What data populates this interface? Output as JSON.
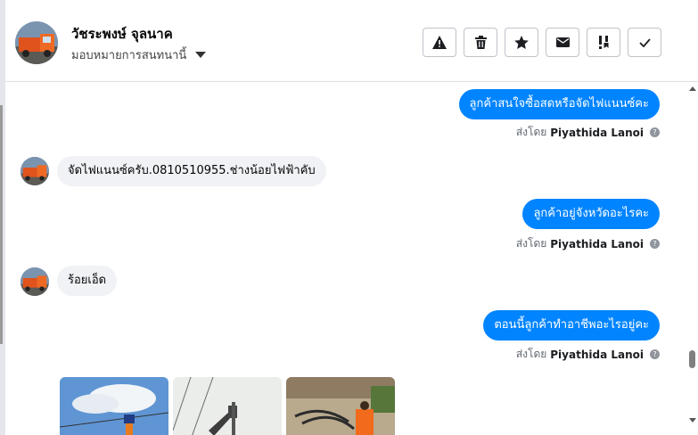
{
  "header": {
    "contact_name": "วัชระพงษ์ จุลนาค",
    "assign_label": "มอบหมายการสนทนานี้",
    "toolbar": [
      {
        "icon": "warning-icon",
        "name": "spam-button"
      },
      {
        "icon": "trash-icon",
        "name": "delete-button"
      },
      {
        "icon": "star-icon",
        "name": "star-button"
      },
      {
        "icon": "envelope-icon",
        "name": "mark-unread-button"
      },
      {
        "icon": "priority-icon",
        "name": "follow-up-button"
      },
      {
        "icon": "check-icon",
        "name": "mark-done-button"
      }
    ]
  },
  "messages": {
    "m1": "ลูกค้าสนใจซื้อสดหรือจัดไฟแนนซ์คะ",
    "m2": "จัดไฟแนนซ์ครับ.0810510955.ช่างน้อยไฟฟ้าคับ",
    "m3": "ลูกค้าอยู่จังหวัดอะไรคะ",
    "m4": "ร้อยเอ็ด",
    "m5": "ตอนนี้ลูกค้าทำอาชีพอะไรอยู่คะ"
  },
  "sent_by": {
    "prefix": "ส่งโดย",
    "agent": "Piyathida Lanoi"
  },
  "colors": {
    "outgoing_bubble": "#0084ff",
    "incoming_bubble": "#f0f2f5"
  }
}
